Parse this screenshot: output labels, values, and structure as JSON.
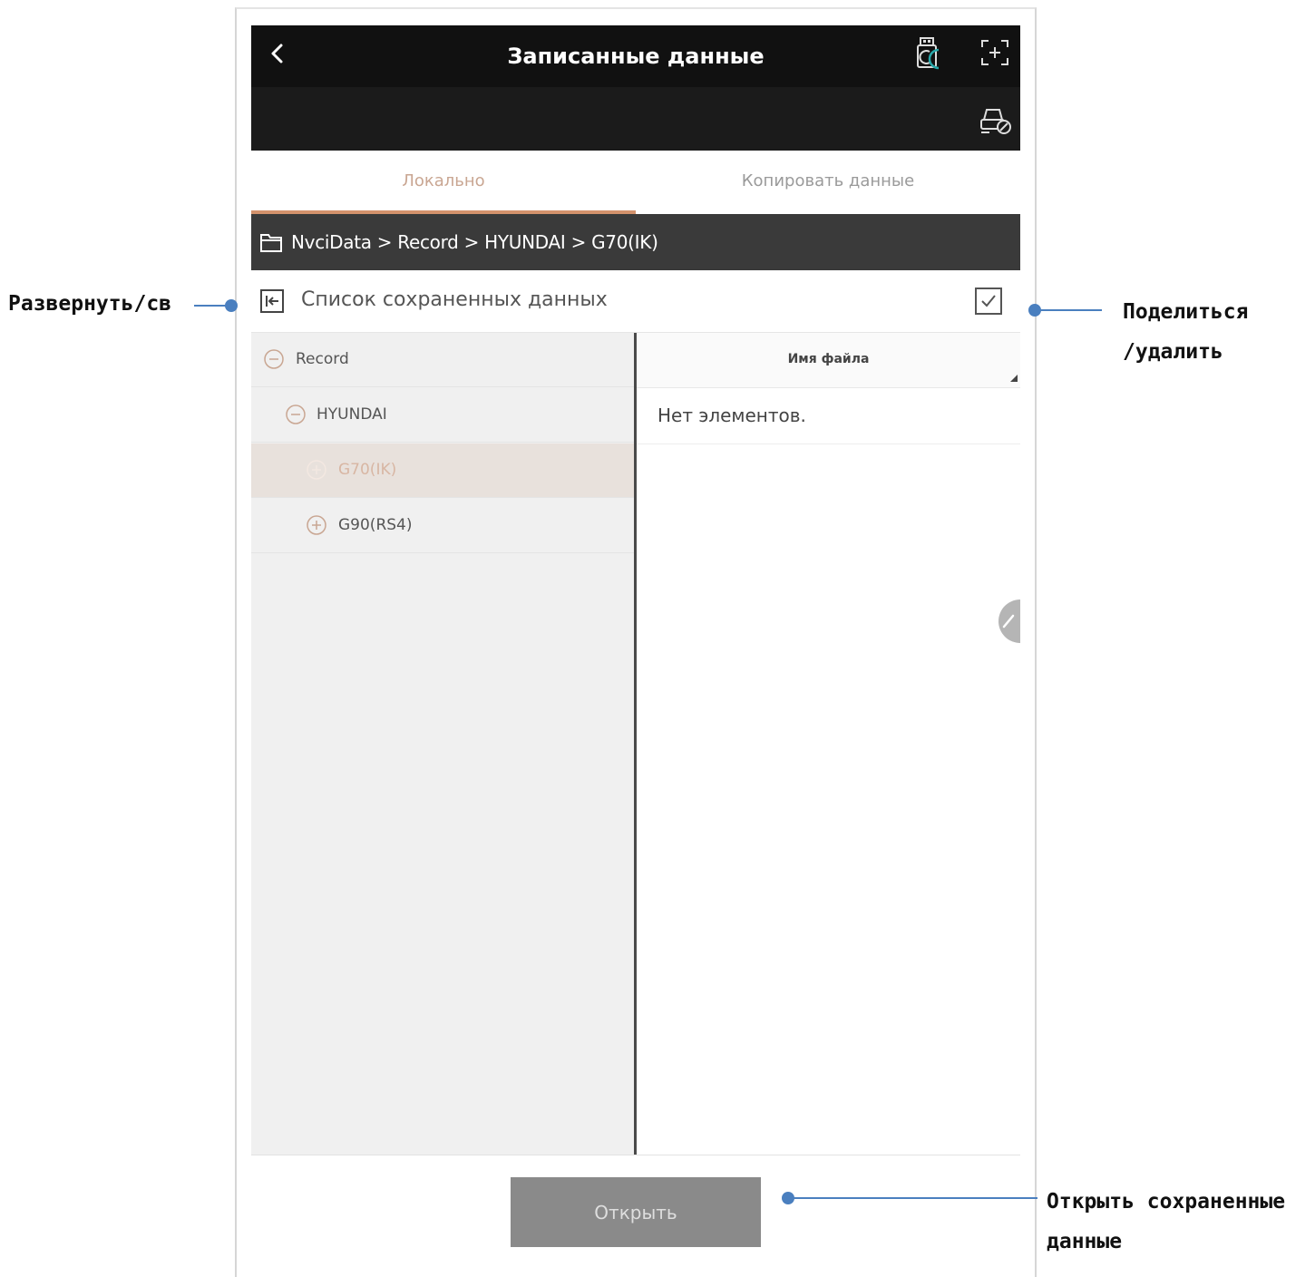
{
  "header": {
    "title": "Записанные данные"
  },
  "tabs": [
    {
      "label": "Локально",
      "active": true
    },
    {
      "label": "Копировать данные",
      "active": false
    }
  ],
  "breadcrumb": {
    "path": "NvciData > Record > HYUNDAI > G70(IK)"
  },
  "list": {
    "title": "Список сохраненных данных"
  },
  "tree": {
    "items": [
      {
        "label": "Record",
        "expanded": true
      },
      {
        "label": "HYUNDAI",
        "expanded": true
      },
      {
        "label": "G70(IK)",
        "expanded": false,
        "selected": true
      },
      {
        "label": "G90(RS4)",
        "expanded": false
      }
    ]
  },
  "files": {
    "column_header": "Имя файла",
    "empty_text": "Нет элементов."
  },
  "footer": {
    "open_label": "Открыть"
  },
  "callouts": {
    "expand": "Развернуть/св",
    "share_line1": "Поделиться",
    "share_line2": "/удалить",
    "open_line1": "Открыть сохраненные",
    "open_line2": "данные"
  },
  "icons": {
    "back": "chevron-left-icon",
    "usb": "usb-drive-icon",
    "screenshot": "capture-frame-icon",
    "vehicle": "car-settings-icon",
    "folder": "folder-icon",
    "expand": "panel-expand-icon",
    "checkbox": "checkbox-icon",
    "collapse": "minus-circle-icon",
    "expand_node": "plus-circle-icon"
  },
  "colors": {
    "header_bg": "#111111",
    "accent": "#d3926c",
    "breadcrumb_bg": "#3a3a3a",
    "button_bg": "#8a8a8a",
    "callout": "#4a7fbf"
  }
}
